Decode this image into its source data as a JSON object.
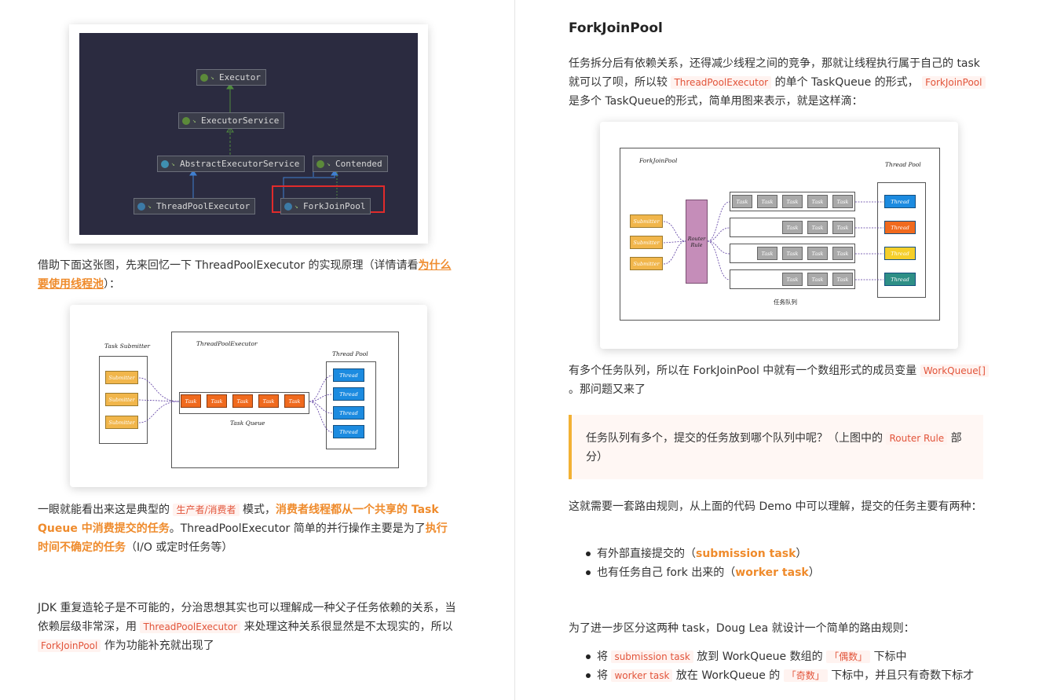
{
  "left": {
    "class_diagram": {
      "nodes": {
        "executor": "Executor",
        "executor_service": "ExecutorService",
        "abstract_executor_service": "AbstractExecutorService",
        "contended": "Contended",
        "thread_pool_executor": "ThreadPoolExecutor",
        "fork_join_pool": "ForkJoinPool"
      },
      "highlight_color": "#e02b2b"
    },
    "para1": {
      "text": "借助下面这张图，先来回忆一下 ThreadPoolExecutor 的实现原理（详情请看",
      "link": "为什么要使用线程池",
      "tail": "）："
    },
    "tpe_diagram": {
      "task_submitter": "Task Submitter",
      "thread_pool_executor": "ThreadPoolExecutor",
      "thread_pool": "Thread Pool",
      "task_queue": "Task Queue",
      "submitter": "Submitter",
      "task": "Task",
      "thread": "Thread"
    },
    "para2": {
      "a": "一眼就能看出来这是典型的",
      "code1": "生产者/消费者",
      "b": "模式，",
      "hl1": "消费者线程都从一个共享的 Task Queue 中消费提交的任务",
      "c": "。ThreadPoolExecutor 简单的并行操作主要是为了",
      "hl2": "执行时间不确定的任务",
      "d": "（I/O 或定时任务等）"
    },
    "para3": {
      "a": "JDK 重复造轮子是不可能的，分治思想其实也可以理解成一种父子任务依赖的关系，当依赖层级非常深，用",
      "code1": "ThreadPoolExecutor",
      "b": "来处理这种关系很显然是不太现实的，所以",
      "code2": "ForkJoinPool",
      "c": "作为功能补充就出现了"
    }
  },
  "right": {
    "heading": "ForkJoinPool",
    "para1": {
      "a": "任务拆分后有依赖关系，还得减少线程之间的竞争，那就让线程执行属于自己的 task 就可以了呗，所以较",
      "code1": "ThreadPoolExecutor",
      "b": "的单个 TaskQueue 的形式，",
      "code2": "ForkJoinPool",
      "c": "是多个 TaskQueue的形式，简单用图来表示，就是这样滴："
    },
    "fjp_diagram": {
      "fork_join_pool": "ForkJoinPool",
      "thread_pool": "Thread Pool",
      "submitter": "Submitter",
      "router_rule": "Router Rule",
      "task": "Task",
      "thread": "Thread",
      "queue_label": "任务队列",
      "thread_colors": [
        "#1c8be0",
        "#f06a1e",
        "#f5cf2a",
        "#2e8f86"
      ]
    },
    "para2": {
      "a": "有多个任务队列，所以在 ForkJoinPool 中就有一个数组形式的成员变量",
      "code1": "WorkQueue[]",
      "b": "。那问题又来了"
    },
    "quote": {
      "a": "任务队列有多个，提交的任务放到哪个队列中呢？（上图中的",
      "code1": "Router Rule",
      "b": "部分）"
    },
    "para3": "这就需要一套路由规则，从上面的代码 Demo 中可以理解，提交的任务主要有两种：",
    "list1": [
      {
        "a": "有外部直接提交的（",
        "hl": "submission task",
        "b": "）"
      },
      {
        "a": "也有任务自己 fork 出来的（",
        "hl": "worker task",
        "b": "）"
      }
    ],
    "para4": "为了进一步区分这两种 task，Doug Lea 就设计一个简单的路由规则：",
    "list2": [
      {
        "a": "将",
        "code": "submission task",
        "b": "放到 WorkQueue 数组的",
        "code2": "「偶数」",
        "c": "下标中"
      },
      {
        "a": "将",
        "code": "worker task",
        "b": "放在 WorkQueue 的",
        "code2": "「奇数」",
        "c": "下标中，并且只有奇数下标才"
      }
    ]
  }
}
